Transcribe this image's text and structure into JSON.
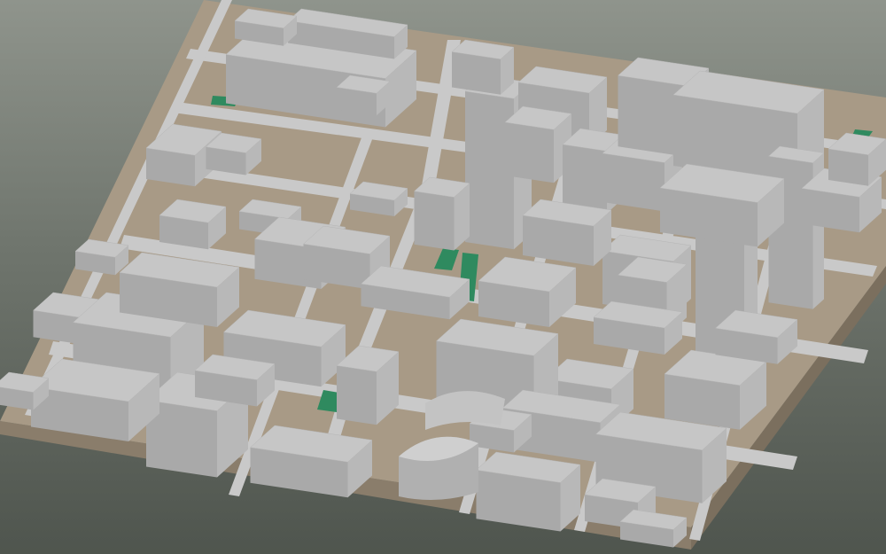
{
  "viewport": {
    "view": "isometric-3d-city-block-model",
    "background_colors": [
      "#8f948c",
      "#4f554e"
    ]
  },
  "model": {
    "base_color": "#a89a86",
    "base_side_color": "#8a7d6b",
    "road_color": "#c9c9c9",
    "building_top_color": "#c6c6c6",
    "building_left_color": "#a9a9a9",
    "building_right_color": "#b8b8b8",
    "park_color": "#2f8a5f",
    "elements": [
      "buildings",
      "roads",
      "parks",
      "towers",
      "rotunda"
    ]
  }
}
